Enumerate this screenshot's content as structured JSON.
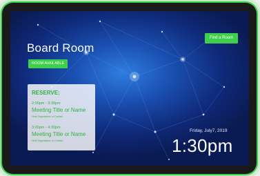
{
  "room": {
    "name": "Board Room",
    "status": "ROOM AVAILABLE"
  },
  "actions": {
    "find_room": "Find a Room"
  },
  "reserve": {
    "title": "RESERVE:",
    "slots": [
      {
        "time": "2:00pm - 3:30pm",
        "title": "Meeting Title or Name",
        "organizer": "Host Organization or Contact"
      },
      {
        "time": "3:00pm - 4:30pm",
        "title": "Meeting Title or Name",
        "organizer": "Host Organization or Contact"
      }
    ]
  },
  "clock": {
    "date": "Friday, July7, 2019",
    "time": "1:30pm"
  },
  "colors": {
    "accent": "#3ecf4c",
    "background": "#1a4fb0"
  }
}
